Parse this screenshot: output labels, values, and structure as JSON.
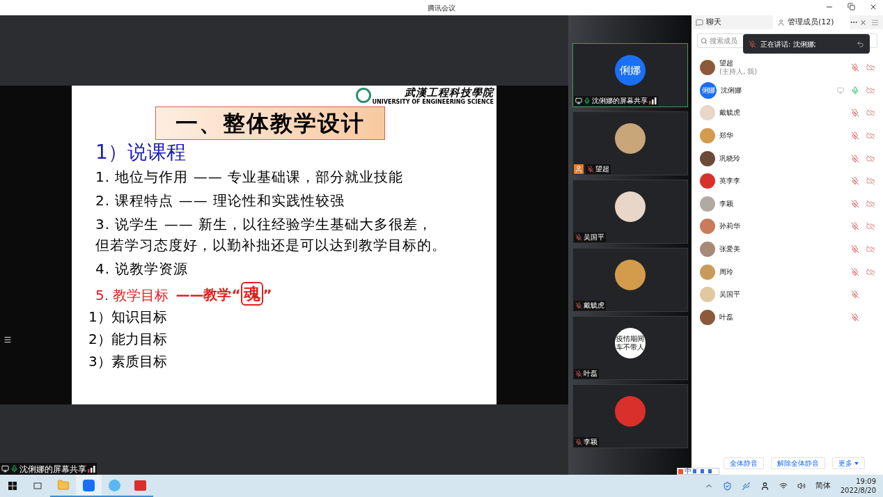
{
  "window": {
    "title": "腾讯会议"
  },
  "slide": {
    "logo_text": "武漢工程科技學院",
    "logo_subtitle": "UNIVERSITY OF ENGINEERING SCIENCE",
    "heading": "一、整体教学设计",
    "section": "1）说课程",
    "items": [
      {
        "kind": "main",
        "lines": [
          "1. 地位与作用  —— 专业基础课，部分就业技能"
        ]
      },
      {
        "kind": "main",
        "lines": [
          "2. 课程特点 —— 理论性和实践性较强"
        ]
      },
      {
        "kind": "main",
        "lines": [
          "3. 说学生 —— 新生，以往经验学生基础大多很差，",
          "但若学习态度好，以勤补拙还是可以达到教学目标的。"
        ]
      },
      {
        "kind": "main",
        "lines": [
          "4. 说教学资源"
        ]
      },
      {
        "kind": "highlight",
        "lines": [
          "5. 教学目标"
        ],
        "note": "——教学“",
        "stamp": "魂",
        "note_end": "”"
      },
      {
        "kind": "sub",
        "lines": [
          "1）知识目标"
        ]
      },
      {
        "kind": "sub",
        "lines": [
          "2）能力目标"
        ]
      },
      {
        "kind": "sub",
        "lines": [
          "3）素质目标"
        ]
      }
    ]
  },
  "share_label": {
    "text": "沈俐娜的屏幕共享",
    "mic_on": true
  },
  "video_tiles": [
    {
      "name": "沈俐娜的屏幕共享",
      "active": true,
      "sharing": true,
      "host": false,
      "mic_on": true,
      "avatar": {
        "kind": "initials",
        "text": "俐娜"
      }
    },
    {
      "name": "望超",
      "active": false,
      "sharing": false,
      "host": true,
      "mic_on": false,
      "avatar": {
        "kind": "photo"
      }
    },
    {
      "name": "吴国平",
      "active": false,
      "sharing": false,
      "host": false,
      "mic_on": false,
      "avatar": {
        "kind": "photo"
      }
    },
    {
      "name": "戴毓虎",
      "active": false,
      "sharing": false,
      "host": false,
      "mic_on": false,
      "avatar": {
        "kind": "photo"
      }
    },
    {
      "name": "叶磊",
      "active": false,
      "sharing": false,
      "host": false,
      "mic_on": false,
      "avatar": {
        "kind": "text",
        "text": "疫情期间车不带人"
      }
    },
    {
      "name": "李颖",
      "active": false,
      "sharing": false,
      "host": false,
      "mic_on": false,
      "avatar": {
        "kind": "photo"
      }
    }
  ],
  "panel": {
    "tabs": [
      {
        "label": "聊天",
        "selected": false
      },
      {
        "label": "管理成员(12)",
        "selected": true
      }
    ],
    "search": {
      "placeholder": "搜索成员"
    },
    "speaking_toast": "正在讲话: 沈俐娜;",
    "members": [
      {
        "name": "望超",
        "note": "(主持人, 我)",
        "avatar": {
          "kind": "photo"
        },
        "mic_on": false,
        "camera": true,
        "sharing": false
      },
      {
        "name": "沈俐娜",
        "avatar": {
          "kind": "initials",
          "text": "俐娜"
        },
        "mic_on": true,
        "camera": true,
        "sharing": true
      },
      {
        "name": "戴毓虎",
        "avatar": {
          "kind": "photo"
        },
        "mic_on": false,
        "camera": true,
        "sharing": false
      },
      {
        "name": "郑华",
        "avatar": {
          "kind": "photo"
        },
        "mic_on": false,
        "camera": true,
        "sharing": false
      },
      {
        "name": "巩晓玲",
        "avatar": {
          "kind": "photo"
        },
        "mic_on": false,
        "camera": true,
        "sharing": false
      },
      {
        "name": "英李李",
        "avatar": {
          "kind": "photo"
        },
        "mic_on": false,
        "camera": true,
        "sharing": false
      },
      {
        "name": "李颖",
        "avatar": {
          "kind": "photo"
        },
        "mic_on": false,
        "camera": true,
        "sharing": false
      },
      {
        "name": "孙莉华",
        "avatar": {
          "kind": "photo"
        },
        "mic_on": false,
        "camera": true,
        "sharing": false
      },
      {
        "name": "张爱美",
        "avatar": {
          "kind": "photo"
        },
        "mic_on": false,
        "camera": true,
        "sharing": false
      },
      {
        "name": "周玲",
        "avatar": {
          "kind": "photo"
        },
        "mic_on": false,
        "camera": true,
        "sharing": false
      },
      {
        "name": "吴国平",
        "avatar": {
          "kind": "photo"
        },
        "mic_on": false,
        "camera": false,
        "sharing": false
      },
      {
        "name": "叶磊",
        "avatar": {
          "kind": "photo"
        },
        "mic_on": false,
        "camera": false,
        "sharing": false
      }
    ],
    "buttons": [
      {
        "label": "全体静音",
        "dropdown": false
      },
      {
        "label": "解除全体静音",
        "dropdown": false
      },
      {
        "label": "更多",
        "dropdown": true
      }
    ]
  },
  "ime_bar": {
    "label": "中"
  },
  "taskbar": {
    "apps": [
      {
        "kind": "folder",
        "selected": false
      },
      {
        "kind": "meeting",
        "selected": true
      },
      {
        "kind": "badge",
        "selected": false
      },
      {
        "kind": "office",
        "selected": false
      }
    ],
    "language": "简体",
    "time": "19:09",
    "date": "2022/8/20"
  }
}
